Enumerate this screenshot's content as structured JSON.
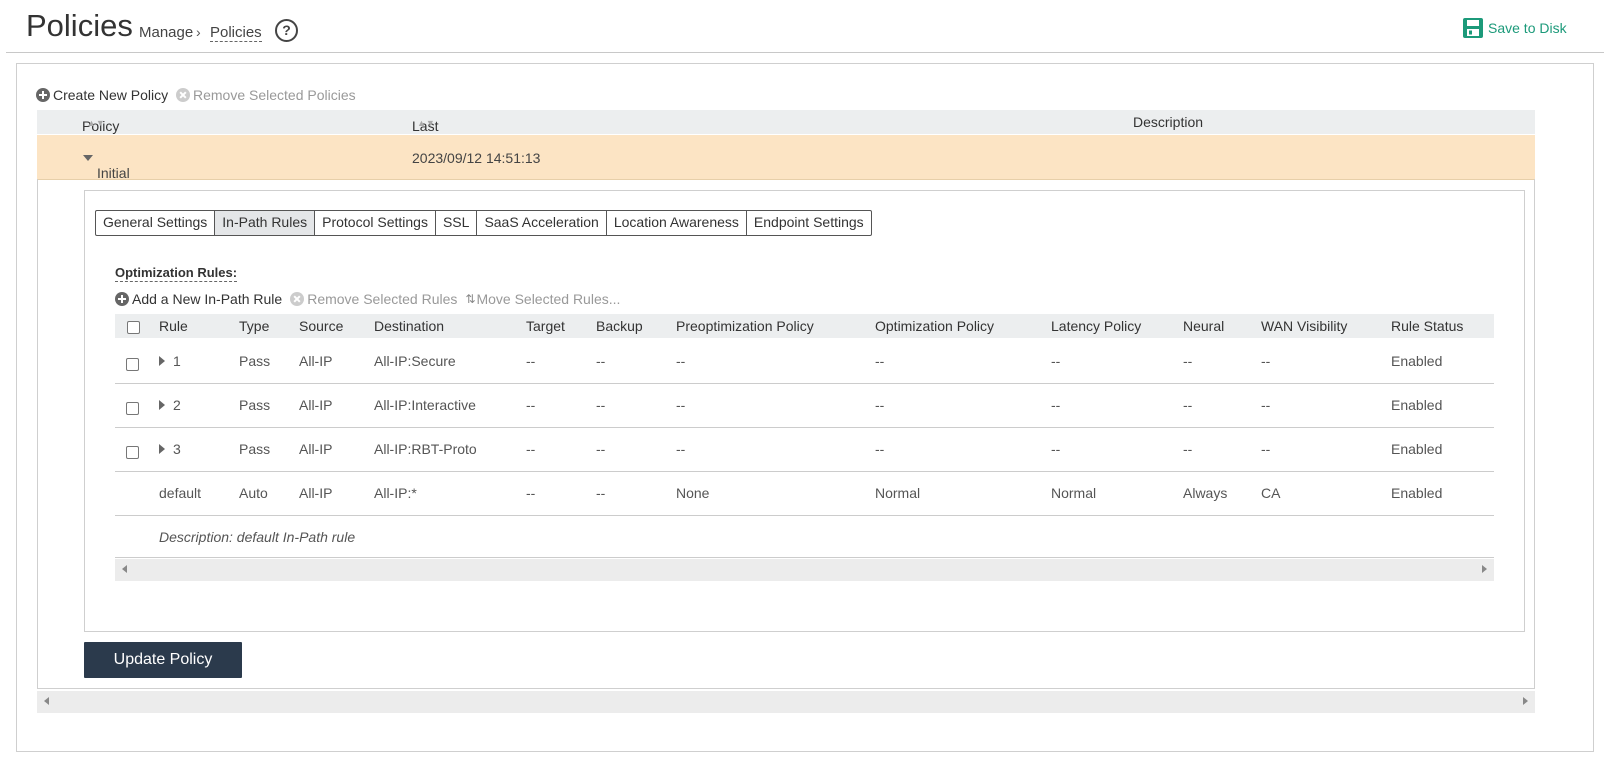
{
  "header": {
    "title": "Policies",
    "breadcrumb": [
      "Manage",
      "Policies"
    ],
    "breadcrumb_sep": "›",
    "help_icon": "?",
    "save_label": "Save to Disk"
  },
  "policy_toolbar": {
    "create_label": "Create New Policy",
    "remove_label": "Remove Selected Policies"
  },
  "policy_table": {
    "columns": [
      "Policy",
      "Last Modified Time",
      "Description"
    ],
    "rows": [
      {
        "name": "Initial",
        "modified": "2023/09/12 14:51:13",
        "description": ""
      }
    ]
  },
  "tabs": [
    "General Settings",
    "In-Path Rules",
    "Protocol Settings",
    "SSL",
    "SaaS Acceleration",
    "Location Awareness",
    "Endpoint Settings"
  ],
  "active_tab": "In-Path Rules",
  "rules": {
    "section_label": "Optimization Rules:",
    "add_label": "Add a New In-Path Rule",
    "remove_label": "Remove Selected Rules",
    "move_label": "Move Selected Rules...",
    "columns": [
      "Rule",
      "Type",
      "Source",
      "Destination",
      "Target",
      "Backup",
      "Preoptimization Policy",
      "Optimization Policy",
      "Latency Policy",
      "Neural",
      "WAN Visibility",
      "Rule Status"
    ],
    "rows": [
      [
        "1",
        "Pass",
        "All-IP",
        "All-IP:Secure",
        "--",
        "--",
        "--",
        "--",
        "--",
        "--",
        "--",
        "Enabled"
      ],
      [
        "2",
        "Pass",
        "All-IP",
        "All-IP:Interactive",
        "--",
        "--",
        "--",
        "--",
        "--",
        "--",
        "--",
        "Enabled"
      ],
      [
        "3",
        "Pass",
        "All-IP",
        "All-IP:RBT-Proto",
        "--",
        "--",
        "--",
        "--",
        "--",
        "--",
        "--",
        "Enabled"
      ],
      [
        "default",
        "Auto",
        "All-IP",
        "All-IP:*",
        "--",
        "--",
        "None",
        "Normal",
        "Normal",
        "Always",
        "CA",
        "Enabled"
      ]
    ],
    "default_description": "Description: default In-Path rule"
  },
  "update_button": "Update Policy",
  "colors": {
    "accent_green": "#1c9a7a",
    "row_highlight": "#fce4c4",
    "button_dark": "#2b3a4c"
  }
}
